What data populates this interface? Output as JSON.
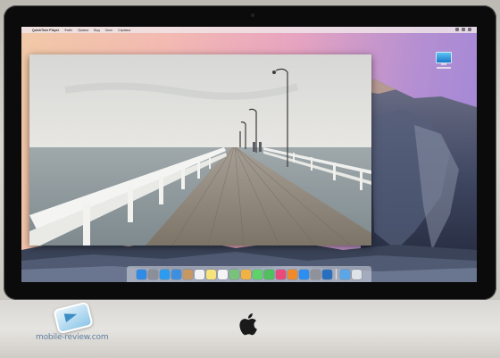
{
  "menubar": {
    "app_name": "QuickTime Player",
    "items": [
      "Файл",
      "Правка",
      "Вид",
      "Окно",
      "Справка"
    ]
  },
  "desktop": {
    "icon_name": "display-icon"
  },
  "photo": {
    "subject": "pier-photo"
  },
  "dock": {
    "icons": [
      {
        "name": "finder-icon",
        "color": "#2f8be6"
      },
      {
        "name": "launchpad-icon",
        "color": "#8a8f99"
      },
      {
        "name": "safari-icon",
        "color": "#2c9cf0"
      },
      {
        "name": "mail-icon",
        "color": "#3f8fe0"
      },
      {
        "name": "contacts-icon",
        "color": "#c79862"
      },
      {
        "name": "calendar-icon",
        "color": "#f2f2f2"
      },
      {
        "name": "notes-icon",
        "color": "#f6e37a"
      },
      {
        "name": "reminders-icon",
        "color": "#f4f4f4"
      },
      {
        "name": "maps-icon",
        "color": "#79c27a"
      },
      {
        "name": "photos-icon",
        "color": "#f0b343"
      },
      {
        "name": "messages-icon",
        "color": "#5ed36a"
      },
      {
        "name": "facetime-icon",
        "color": "#4fc05c"
      },
      {
        "name": "itunes-icon",
        "color": "#e84b7a"
      },
      {
        "name": "ibooks-icon",
        "color": "#f08a2a"
      },
      {
        "name": "appstore-icon",
        "color": "#2c8ef0"
      },
      {
        "name": "preferences-icon",
        "color": "#8f9399"
      },
      {
        "name": "quicktime-icon",
        "color": "#2a6fbd"
      }
    ],
    "trailing": [
      {
        "name": "downloads-folder-icon",
        "color": "#5aa6e8"
      },
      {
        "name": "trash-icon",
        "color": "#dfe3e8"
      }
    ]
  },
  "watermark": {
    "text": "mobile-review.com"
  },
  "colors": {
    "bezel": "#0b0b0c",
    "chin": "#e2e0dc"
  }
}
